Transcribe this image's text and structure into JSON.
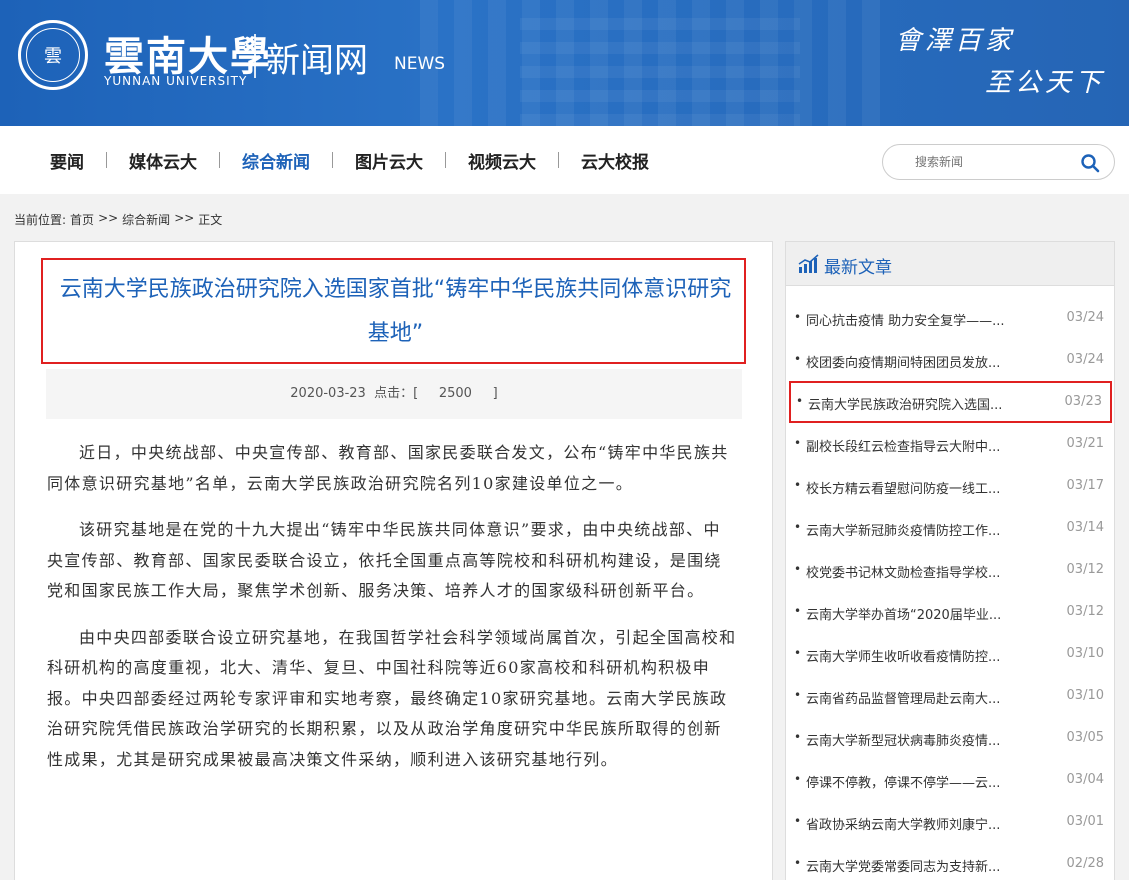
{
  "header": {
    "seal_text": "雲",
    "university_cn": "雲南大學",
    "university_en": "YUNNAN UNIVERSITY",
    "site_cn": "新闻网",
    "site_en": "NEWS",
    "motto_line1": "會澤百家",
    "motto_line2": "至公天下"
  },
  "nav": {
    "items": [
      {
        "label": "要闻"
      },
      {
        "label": "媒体云大"
      },
      {
        "label": "综合新闻"
      },
      {
        "label": "图片云大"
      },
      {
        "label": "视频云大"
      },
      {
        "label": "云大校报"
      }
    ],
    "active_index": 2,
    "search_placeholder": "搜索新闻"
  },
  "breadcrumb": {
    "prefix": "当前位置:",
    "items": [
      "首页",
      ">>",
      "综合新闻",
      ">>",
      "正文"
    ]
  },
  "article": {
    "title": "云南大学民族政治研究院入选国家首批“铸牢中华民族共同体意识研究基地”",
    "date": "2020-03-23",
    "clicks_label": "点击：[",
    "clicks": "2500",
    "clicks_end": "]",
    "paragraphs": [
      "近日，中央统战部、中央宣传部、教育部、国家民委联合发文，公布“铸牢中华民族共同体意识研究基地”名单，云南大学民族政治研究院名列10家建设单位之一。",
      "该研究基地是在党的十九大提出“铸牢中华民族共同体意识”要求，由中央统战部、中央宣传部、教育部、国家民委联合设立，依托全国重点高等院校和科研机构建设，是围绕党和国家民族工作大局，聚焦学术创新、服务决策、培养人才的国家级科研创新平台。",
      "由中央四部委联合设立研究基地，在我国哲学社会科学领域尚属首次，引起全国高校和科研机构的高度重视，北大、清华、复旦、中国社科院等近60家高校和科研机构积极申报。中央四部委经过两轮专家评审和实地考察，最终确定10家研究基地。云南大学民族政治研究院凭借民族政治学研究的长期积累，以及从政治学角度研究中华民族所取得的创新性成果，尤其是研究成果被最高决策文件采纳，顺利进入该研究基地行列。"
    ]
  },
  "sidebar": {
    "heading": "最新文章",
    "items": [
      {
        "title": "同心抗击疫情 助力安全复学——...",
        "date": "03/24"
      },
      {
        "title": "校团委向疫情期间特困团员发放...",
        "date": "03/24"
      },
      {
        "title": "云南大学民族政治研究院入选国...",
        "date": "03/23"
      },
      {
        "title": "副校长段红云检查指导云大附中...",
        "date": "03/21"
      },
      {
        "title": "校长方精云看望慰问防疫一线工...",
        "date": "03/17"
      },
      {
        "title": "云南大学新冠肺炎疫情防控工作...",
        "date": "03/14"
      },
      {
        "title": "校党委书记林文勋检查指导学校...",
        "date": "03/12"
      },
      {
        "title": "云南大学举办首场“2020届毕业...",
        "date": "03/12"
      },
      {
        "title": "云南大学师生收听收看疫情防控...",
        "date": "03/10"
      },
      {
        "title": "云南省药品监督管理局赴云南大...",
        "date": "03/10"
      },
      {
        "title": "云南大学新型冠状病毒肺炎疫情...",
        "date": "03/05"
      },
      {
        "title": "停课不停教，停课不停学——云...",
        "date": "03/04"
      },
      {
        "title": "省政协采纳云南大学教师刘康宁...",
        "date": "03/01"
      },
      {
        "title": "云南大学党委常委同志为支持新...",
        "date": "02/28"
      }
    ],
    "highlight_index": 2
  },
  "colors": {
    "brand_blue": "#1d62b8",
    "highlight_red": "#e02020"
  }
}
